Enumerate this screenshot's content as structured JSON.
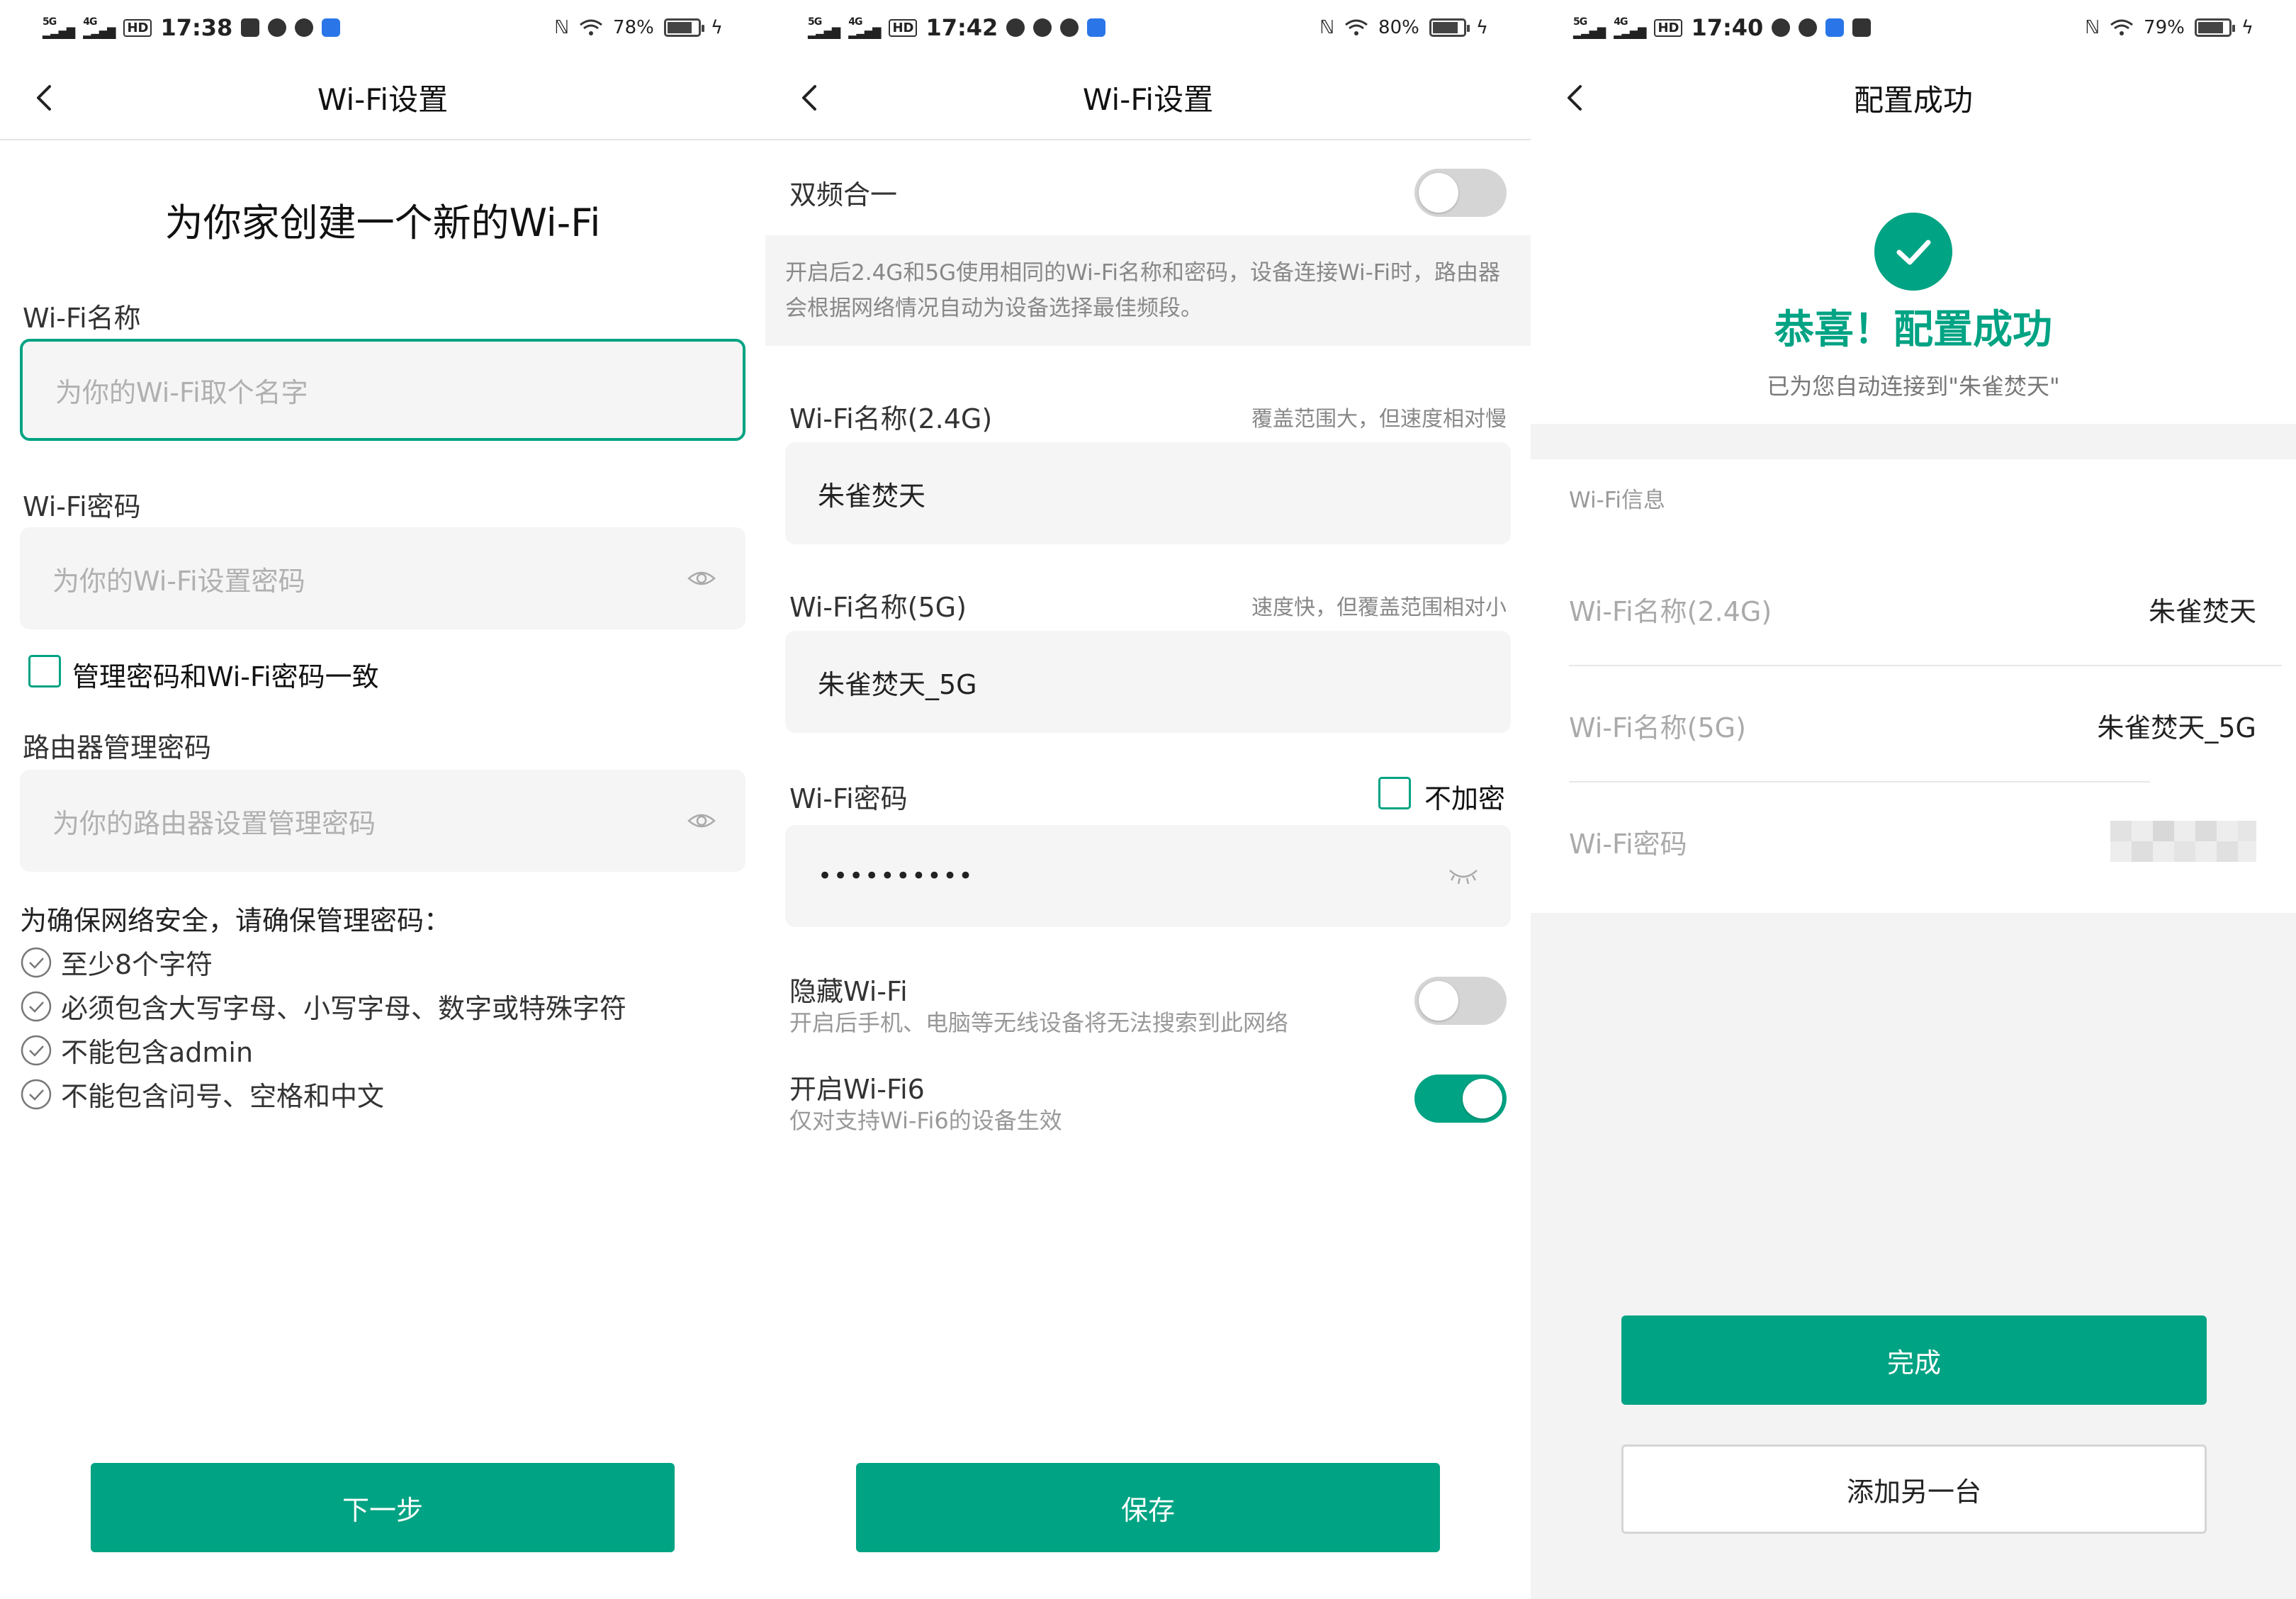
{
  "screens": [
    {
      "status": {
        "time": "17:38",
        "battery": "78%",
        "battery_level": 0.78
      },
      "nav": {
        "title": "Wi-Fi设置"
      },
      "heading": "为你家创建一个新的Wi-Fi",
      "wifi_name": {
        "label": "Wi-Fi名称",
        "placeholder": "为你的Wi-Fi取个名字"
      },
      "wifi_password": {
        "label": "Wi-Fi密码",
        "placeholder": "为你的Wi-Fi设置密码"
      },
      "same_password_checkbox": {
        "label": "管理密码和Wi-Fi密码一致",
        "checked": false
      },
      "admin_password": {
        "label": "路由器管理密码",
        "placeholder": "为你的路由器设置管理密码"
      },
      "rules_title": "为确保网络安全，请确保管理密码：",
      "rules": [
        "至少8个字符",
        "必须包含大写字母、小写字母、数字或特殊字符",
        "不能包含admin",
        "不能包含问号、空格和中文"
      ],
      "next_button": "下一步"
    },
    {
      "status": {
        "time": "17:42",
        "battery": "80%",
        "battery_level": 0.8
      },
      "nav": {
        "title": "Wi-Fi设置"
      },
      "dual_band": {
        "label": "双频合一",
        "on": false
      },
      "dual_band_desc": "开启后2.4G和5G使用相同的Wi-Fi名称和密码，设备连接Wi-Fi时，路由器会根据网络情况自动为设备选择最佳频段。",
      "wifi_24": {
        "label": "Wi-Fi名称(2.4G)",
        "hint": "覆盖范围大，但速度相对慢",
        "value": "朱雀焚天"
      },
      "wifi_5": {
        "label": "Wi-Fi名称(5G)",
        "hint": "速度快，但覆盖范围相对小",
        "value": "朱雀焚天_5G"
      },
      "wifi_password": {
        "label": "Wi-Fi密码",
        "no_encrypt_label": "不加密",
        "no_encrypt_checked": false,
        "value": "••••••••••"
      },
      "hide_wifi": {
        "label": "隐藏Wi-Fi",
        "desc": "开启后手机、电脑等无线设备将无法搜索到此网络",
        "on": false
      },
      "wifi6": {
        "label": "开启Wi-Fi6",
        "desc": "仅对支持Wi-Fi6的设备生效",
        "on": true
      },
      "save_button": "保存"
    },
    {
      "status": {
        "time": "17:40",
        "battery": "79%",
        "battery_level": 0.79
      },
      "nav": {
        "title": "配置成功"
      },
      "success_title": "恭喜！配置成功",
      "success_sub": "已为您自动连接到\"朱雀焚天\"",
      "info_title": "Wi-Fi信息",
      "info": [
        {
          "key": "Wi-Fi名称(2.4G)",
          "value": "朱雀焚天"
        },
        {
          "key": "Wi-Fi名称(5G)",
          "value": "朱雀焚天_5G"
        },
        {
          "key": "Wi-Fi密码",
          "value": ""
        }
      ],
      "done_button": "完成",
      "add_button": "添加另一台"
    }
  ],
  "colors": {
    "accent": "#00a383",
    "field_bg": "#f5f5f5"
  }
}
